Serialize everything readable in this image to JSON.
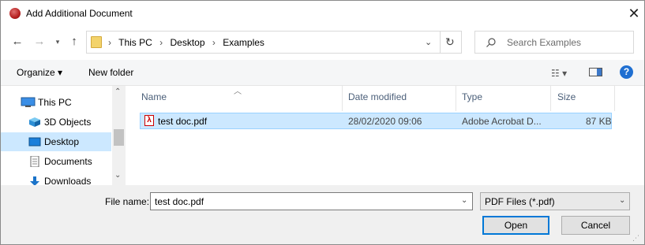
{
  "window": {
    "title": "Add Additional Document",
    "close_glyph": "✕"
  },
  "address": {
    "crumbs": [
      "This PC",
      "Desktop",
      "Examples"
    ],
    "search_placeholder": "Search Examples"
  },
  "commands": {
    "organize": "Organize ▾",
    "new_folder": "New folder"
  },
  "nav": {
    "items": [
      {
        "label": "This PC",
        "icon": "pc-icon"
      },
      {
        "label": "3D Objects",
        "icon": "cube-icon"
      },
      {
        "label": "Desktop",
        "icon": "desktop-icon",
        "selected": true
      },
      {
        "label": "Documents",
        "icon": "document-icon"
      },
      {
        "label": "Downloads",
        "icon": "download-icon"
      }
    ]
  },
  "files": {
    "columns": [
      "Name",
      "Date modified",
      "Type",
      "Size"
    ],
    "rows": [
      {
        "name": "test doc.pdf",
        "date": "28/02/2020 09:06",
        "type": "Adobe Acrobat D...",
        "size": "87 KB",
        "selected": true
      }
    ]
  },
  "footer": {
    "file_name_label": "File name:",
    "file_name_value": "test doc.pdf",
    "filter_value": "PDF Files (*.pdf)",
    "open_label": "Open",
    "cancel_label": "Cancel"
  },
  "colors": {
    "selection": "#cce8ff",
    "accent": "#0078d7"
  }
}
